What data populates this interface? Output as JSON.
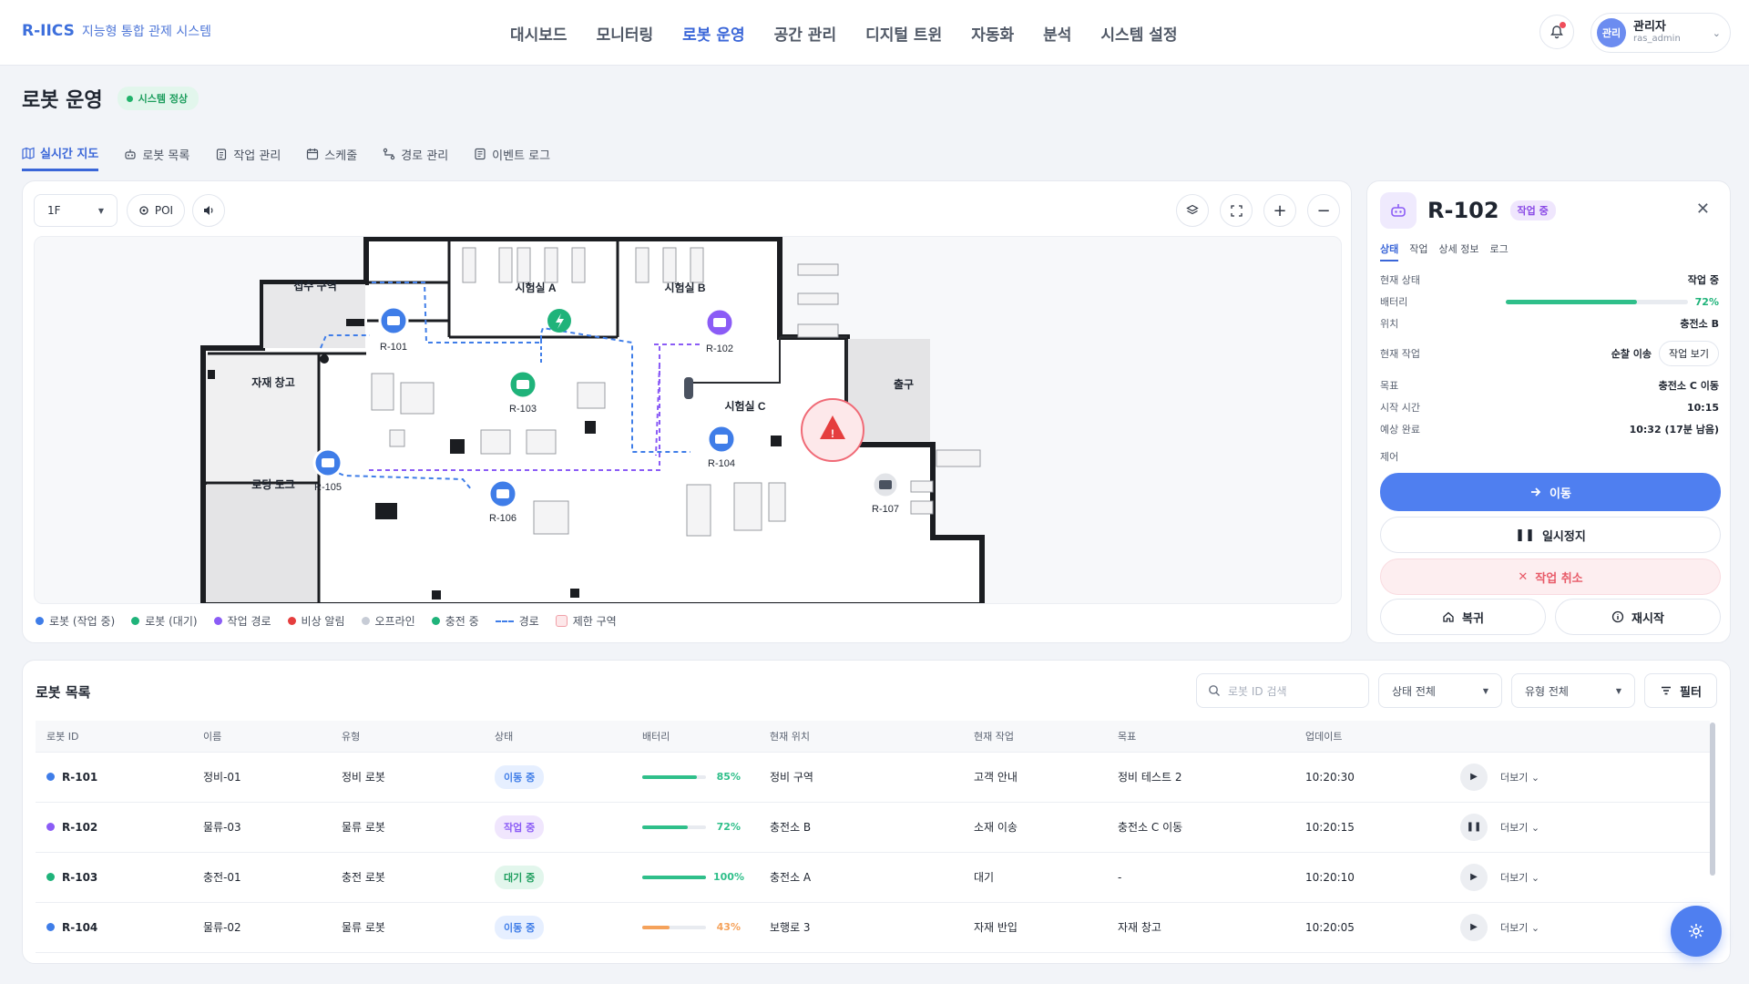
{
  "brand": {
    "logo": "R-IICS",
    "subtitle": "지능형 통합 관제 시스템"
  },
  "nav": [
    {
      "label": "대시보드",
      "active": false
    },
    {
      "label": "모니터링",
      "active": false
    },
    {
      "label": "로봇 운영",
      "active": true
    },
    {
      "label": "공간 관리",
      "active": false
    },
    {
      "label": "디지털 트윈",
      "active": false
    },
    {
      "label": "자동화",
      "active": false
    },
    {
      "label": "분석",
      "active": false
    },
    {
      "label": "시스템 설정",
      "active": false
    }
  ],
  "user": {
    "avatar": "관리",
    "name": "관리자",
    "id": "ras_admin"
  },
  "page": {
    "title": "로봇 운영",
    "status": "시스템 정상"
  },
  "subtabs": [
    {
      "label": "실시간 지도",
      "icon": "map-icon",
      "active": true
    },
    {
      "label": "로봇 목록",
      "icon": "robot-icon",
      "active": false
    },
    {
      "label": "작업 관리",
      "icon": "clipboard-icon",
      "active": false
    },
    {
      "label": "스케줄",
      "icon": "calendar-icon",
      "active": false
    },
    {
      "label": "경로 관리",
      "icon": "route-icon",
      "active": false
    },
    {
      "label": "이벤트 로그",
      "icon": "log-icon",
      "active": false
    }
  ],
  "map": {
    "floor": "1F",
    "poi": "POI",
    "rooms": {
      "reception": "접수 구역",
      "labA": "시험실 A",
      "labB": "시험실 B",
      "storage": "자재 창고",
      "labC": "시험실 C",
      "exit": "출구",
      "dock": "로딩 도크"
    },
    "robots": [
      {
        "id": "R-101",
        "state": "moving"
      },
      {
        "id": "R-102",
        "state": "working"
      },
      {
        "id": "R-103",
        "state": "idle"
      },
      {
        "id": "R-104",
        "state": "moving"
      },
      {
        "id": "R-105",
        "state": "moving"
      },
      {
        "id": "R-106",
        "state": "moving"
      },
      {
        "id": "R-107",
        "state": "offline"
      }
    ],
    "legend": [
      {
        "label": "로봇 (작업 중)",
        "color": "#3f7de8",
        "kind": "dot"
      },
      {
        "label": "로봇 (대기)",
        "color": "#1fb37a",
        "kind": "dot"
      },
      {
        "label": "작업 경로",
        "color": "#8b5cf6",
        "kind": "dot"
      },
      {
        "label": "비상 알림",
        "color": "#e53e3e",
        "kind": "dot"
      },
      {
        "label": "오프라인",
        "color": "#c7ccd6",
        "kind": "dot"
      },
      {
        "label": "충전 중",
        "color": "#1fb37a",
        "kind": "dot"
      },
      {
        "label": "경로",
        "color": "#3f7de8",
        "kind": "dash"
      },
      {
        "label": "제한 구역",
        "color": "#f0a0a8",
        "kind": "box"
      }
    ]
  },
  "detail": {
    "id": "R-102",
    "status_pill": "작업 중",
    "tabs": [
      "상태",
      "작업",
      "상세 정보",
      "로그"
    ],
    "rows": {
      "status": {
        "label": "현재 상태",
        "value": "작업 중"
      },
      "battery": {
        "label": "배터리",
        "value": "72%",
        "level": 72
      },
      "location": {
        "label": "위치",
        "value": "충전소 B"
      },
      "task": {
        "label": "현재 작업",
        "value": "순찰 이송",
        "action": "작업 보기"
      },
      "goal": {
        "label": "목표",
        "value": "충전소 C 이동"
      },
      "start": {
        "label": "시작 시간",
        "value": "10:15"
      },
      "eta": {
        "label": "예상 완료",
        "value": "10:32 (17분 남음)"
      }
    },
    "control_label": "제어",
    "buttons": {
      "move": "이동",
      "pause": "일시정지",
      "cancel": "작업 취소",
      "home": "복귀",
      "restart": "재시작"
    }
  },
  "list": {
    "title": "로봇 목록",
    "search_placeholder": "로봇 ID 검색",
    "status_filter": "상태 전체",
    "type_filter": "유형 전체",
    "filter_label": "필터",
    "columns": [
      "로봇 ID",
      "이름",
      "유형",
      "상태",
      "배터리",
      "현재 위치",
      "현재 작업",
      "목표",
      "업데이트"
    ],
    "rows": [
      {
        "id": "R-101",
        "dot": "#3f7de8",
        "name": "정비-01",
        "type": "정비 로봇",
        "status": "이동 중",
        "status_kind": "blue",
        "battery": "85%",
        "level": 85,
        "bat_color": "#2fbf8a",
        "location": "정비 구역",
        "task": "고객 안내",
        "goal": "정비 테스트 2",
        "updated": "10:20:30",
        "action": "play",
        "more": "더보기"
      },
      {
        "id": "R-102",
        "dot": "#8b5cf6",
        "name": "물류-03",
        "type": "물류 로봇",
        "status": "작업 중",
        "status_kind": "purple",
        "battery": "72%",
        "level": 72,
        "bat_color": "#2fbf8a",
        "location": "충전소 B",
        "task": "소재 이송",
        "goal": "충전소 C 이동",
        "updated": "10:20:15",
        "action": "pause",
        "more": "더보기"
      },
      {
        "id": "R-103",
        "dot": "#1fb37a",
        "name": "충전-01",
        "type": "충전 로봇",
        "status": "대기 중",
        "status_kind": "green",
        "battery": "100%",
        "level": 100,
        "bat_color": "#2fbf8a",
        "location": "충전소 A",
        "task": "대기",
        "goal": "-",
        "updated": "10:20:10",
        "action": "play",
        "more": "더보기"
      },
      {
        "id": "R-104",
        "dot": "#3f7de8",
        "name": "물류-02",
        "type": "물류 로봇",
        "status": "이동 중",
        "status_kind": "blue",
        "battery": "43%",
        "level": 43,
        "bat_color": "#f5a25b",
        "location": "보행로 3",
        "task": "자재 반입",
        "goal": "자재 창고",
        "updated": "10:20:05",
        "action": "play",
        "more": "더보기"
      }
    ]
  }
}
